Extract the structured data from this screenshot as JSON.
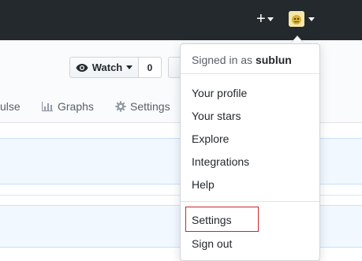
{
  "header": {
    "plus_label": "+",
    "colors": {
      "bg": "#24292e"
    }
  },
  "repo": {
    "watch_label": "Watch",
    "watch_count": "0",
    "tabs": {
      "pulse": "ulse",
      "graphs": "Graphs",
      "settings": "Settings"
    }
  },
  "dropdown": {
    "signed_in_prefix": "Signed in as",
    "username": "sublun",
    "items": [
      "Your profile",
      "Your stars",
      "Explore",
      "Integrations",
      "Help"
    ],
    "settings": "Settings",
    "sign_out": "Sign out",
    "highlight_color": "#c8262e"
  }
}
